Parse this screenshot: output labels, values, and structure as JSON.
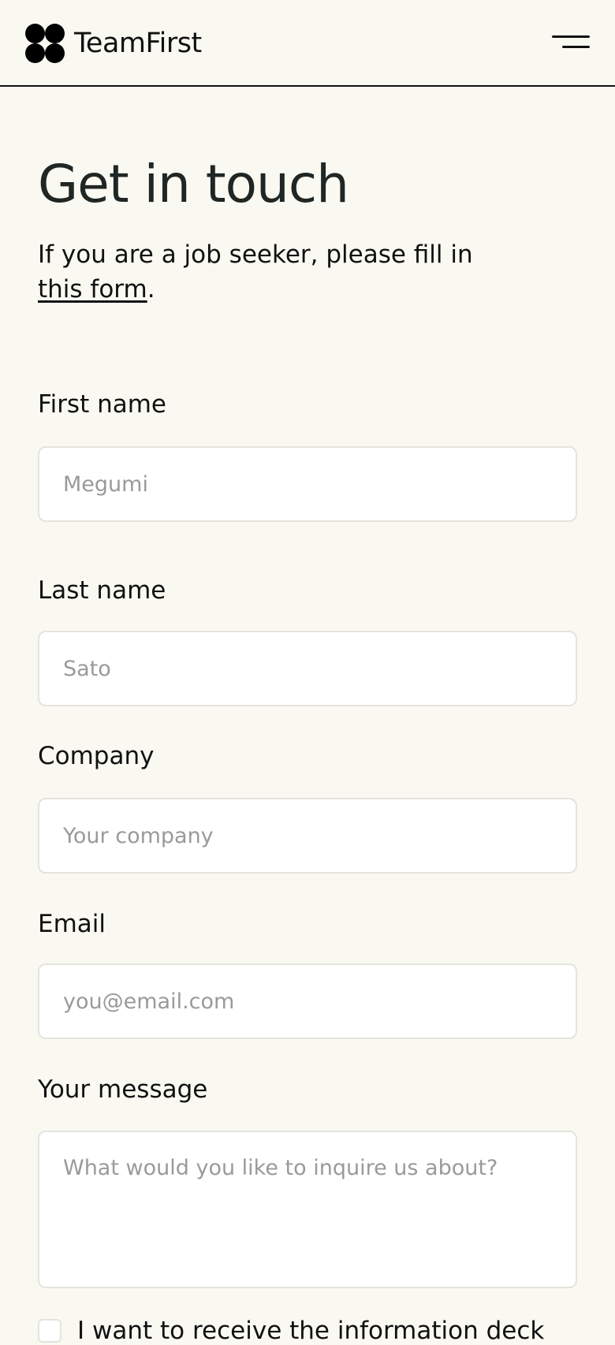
{
  "header": {
    "brand": "TeamFirst",
    "menu_icon": "hamburger-icon"
  },
  "main": {
    "title": "Get in touch",
    "intro_text": "If you are a job seeker, please fill in",
    "intro_link": "this form",
    "intro_end": "."
  },
  "form": {
    "first_name": {
      "label": "First name",
      "placeholder": "Megumi"
    },
    "last_name": {
      "label": "Last name",
      "placeholder": "Sato"
    },
    "company": {
      "label": "Company",
      "placeholder": "Your company"
    },
    "email": {
      "label": "Email",
      "placeholder": "you@email.com"
    },
    "message": {
      "label": "Your message",
      "placeholder": "What would you like to inquire us about?"
    },
    "info_deck_checkbox": {
      "label": "I want to receive the information deck"
    }
  },
  "colors": {
    "background": "#F9F9F1",
    "text": "#1B1F1C",
    "input_border": "#E4E4DE",
    "placeholder": "#9A9A9A"
  }
}
